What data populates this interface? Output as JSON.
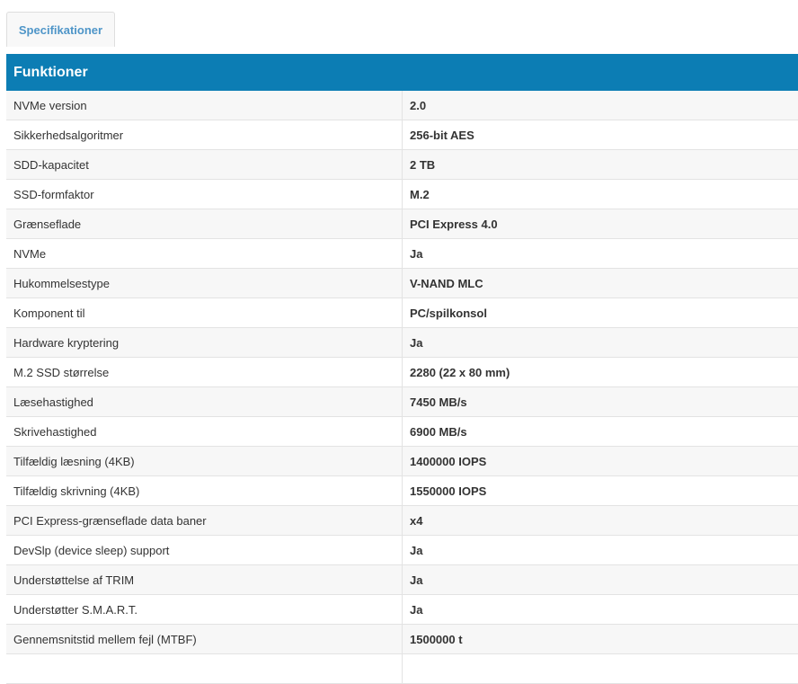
{
  "tab": {
    "label": "Specifikationer"
  },
  "section": {
    "title": "Funktioner"
  },
  "rows": [
    {
      "label": "NVMe version",
      "value": "2.0"
    },
    {
      "label": "Sikkerhedsalgoritmer",
      "value": "256-bit AES"
    },
    {
      "label": "SDD-kapacitet",
      "value": "2 TB"
    },
    {
      "label": "SSD-formfaktor",
      "value": "M.2"
    },
    {
      "label": "Grænseflade",
      "value": "PCI Express 4.0"
    },
    {
      "label": "NVMe",
      "value": "Ja"
    },
    {
      "label": "Hukommelsestype",
      "value": "V-NAND MLC"
    },
    {
      "label": "Komponent til",
      "value": "PC/spilkonsol"
    },
    {
      "label": "Hardware kryptering",
      "value": "Ja"
    },
    {
      "label": "M.2 SSD størrelse",
      "value": "2280 (22 x 80 mm)"
    },
    {
      "label": "Læsehastighed",
      "value": "7450 MB/s"
    },
    {
      "label": "Skrivehastighed",
      "value": "6900 MB/s"
    },
    {
      "label": "Tilfældig læsning (4KB)",
      "value": "1400000 IOPS"
    },
    {
      "label": "Tilfældig skrivning (4KB)",
      "value": "1550000 IOPS"
    },
    {
      "label": "PCI Express-grænseflade data baner",
      "value": "x4"
    },
    {
      "label": "DevSlp (device sleep) support",
      "value": "Ja"
    },
    {
      "label": "Understøttelse af TRIM",
      "value": "Ja"
    },
    {
      "label": "Understøtter S.M.A.R.T.",
      "value": "Ja"
    },
    {
      "label": "Gennemsnitstid mellem fejl (MTBF)",
      "value": "1500000 t"
    },
    {
      "label": "",
      "value": ""
    }
  ],
  "colors": {
    "header_bg": "#0c7db4",
    "tab_text": "#4e95c8",
    "row_alt_bg": "#f7f7f7"
  }
}
